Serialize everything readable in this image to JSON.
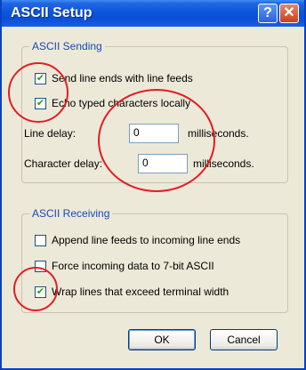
{
  "window": {
    "title": "ASCII Setup"
  },
  "titlebar_buttons": {
    "help_icon": "?",
    "close_icon": "✕"
  },
  "ascii_sending": {
    "legend": "ASCII Sending",
    "send_line_ends": {
      "label": "Send line ends with line feeds",
      "checked": true
    },
    "echo_typed": {
      "label": "Echo typed characters locally",
      "checked": true
    },
    "line_delay": {
      "label": "Line delay:",
      "value": "0",
      "unit": "milliseconds."
    },
    "char_delay": {
      "label": "Character delay:",
      "value": "0",
      "unit": "milliseconds."
    }
  },
  "ascii_receiving": {
    "legend": "ASCII Receiving",
    "append_line_feeds": {
      "label": "Append line feeds to incoming line ends",
      "checked": false
    },
    "force_7bit": {
      "label": "Force incoming data to 7-bit ASCII",
      "checked": false
    },
    "wrap_lines": {
      "label": "Wrap lines that exceed terminal width",
      "checked": true
    }
  },
  "buttons": {
    "ok": "OK",
    "cancel": "Cancel"
  },
  "checkmark_glyph": "✔",
  "colors": {
    "titlebar": "#0a4fd6",
    "annotation": "#e31d25",
    "group_label": "#1a48b8"
  }
}
